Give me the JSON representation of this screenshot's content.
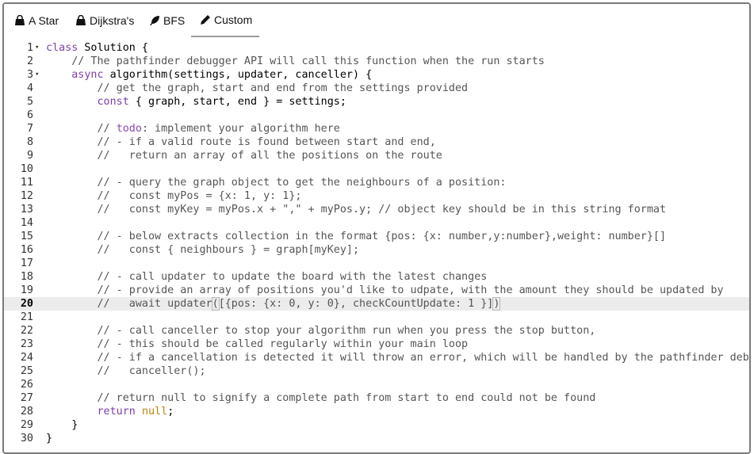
{
  "tabs": [
    {
      "label": "A Star",
      "icon": "bag-icon"
    },
    {
      "label": "Dijkstra's",
      "icon": "bag-icon"
    },
    {
      "label": "BFS",
      "icon": "feather-icon"
    },
    {
      "label": "Custom",
      "icon": "pencil-icon",
      "active": true
    }
  ],
  "editor": {
    "active_line": 20,
    "fold_lines": [
      1,
      3
    ],
    "lines": [
      "class Solution {",
      "    // The pathfinder debugger API will call this function when the run starts",
      "    async algorithm(settings, updater, canceller) {",
      "        // get the graph, start and end from the settings provided",
      "        const { graph, start, end } = settings;",
      "",
      "        // todo: implement your algorithm here",
      "        // - if a valid route is found between start and end,",
      "        //   return an array of all the positions on the route",
      "",
      "        // - query the graph object to get the neighbours of a position:",
      "        //   const myPos = {x: 1, y: 1};",
      "        //   const myKey = myPos.x + \",\" + myPos.y; // object key should be in this string format",
      "",
      "        // - below extracts collection in the format {pos: {x: number,y:number},weight: number}[]",
      "        //   const { neighbours } = graph[myKey];",
      "",
      "        // - call updater to update the board with the latest changes",
      "        // - provide an array of positions you'd like to udpate, with the amount they should be updated by",
      "        //   await updater([{pos: {x: 0, y: 0}, checkCountUpdate: 1 }])",
      "",
      "        // - call canceller to stop your algorithm run when you press the stop button,",
      "        // - this should be called regularly within your main loop",
      "        // - if a cancellation is detected it will throw an error, which will be handled by the pathfinder debu",
      "        //   canceller();",
      "",
      "        // return null to signify a complete path from start to end could not be found",
      "        return null;",
      "    }",
      "}"
    ]
  }
}
